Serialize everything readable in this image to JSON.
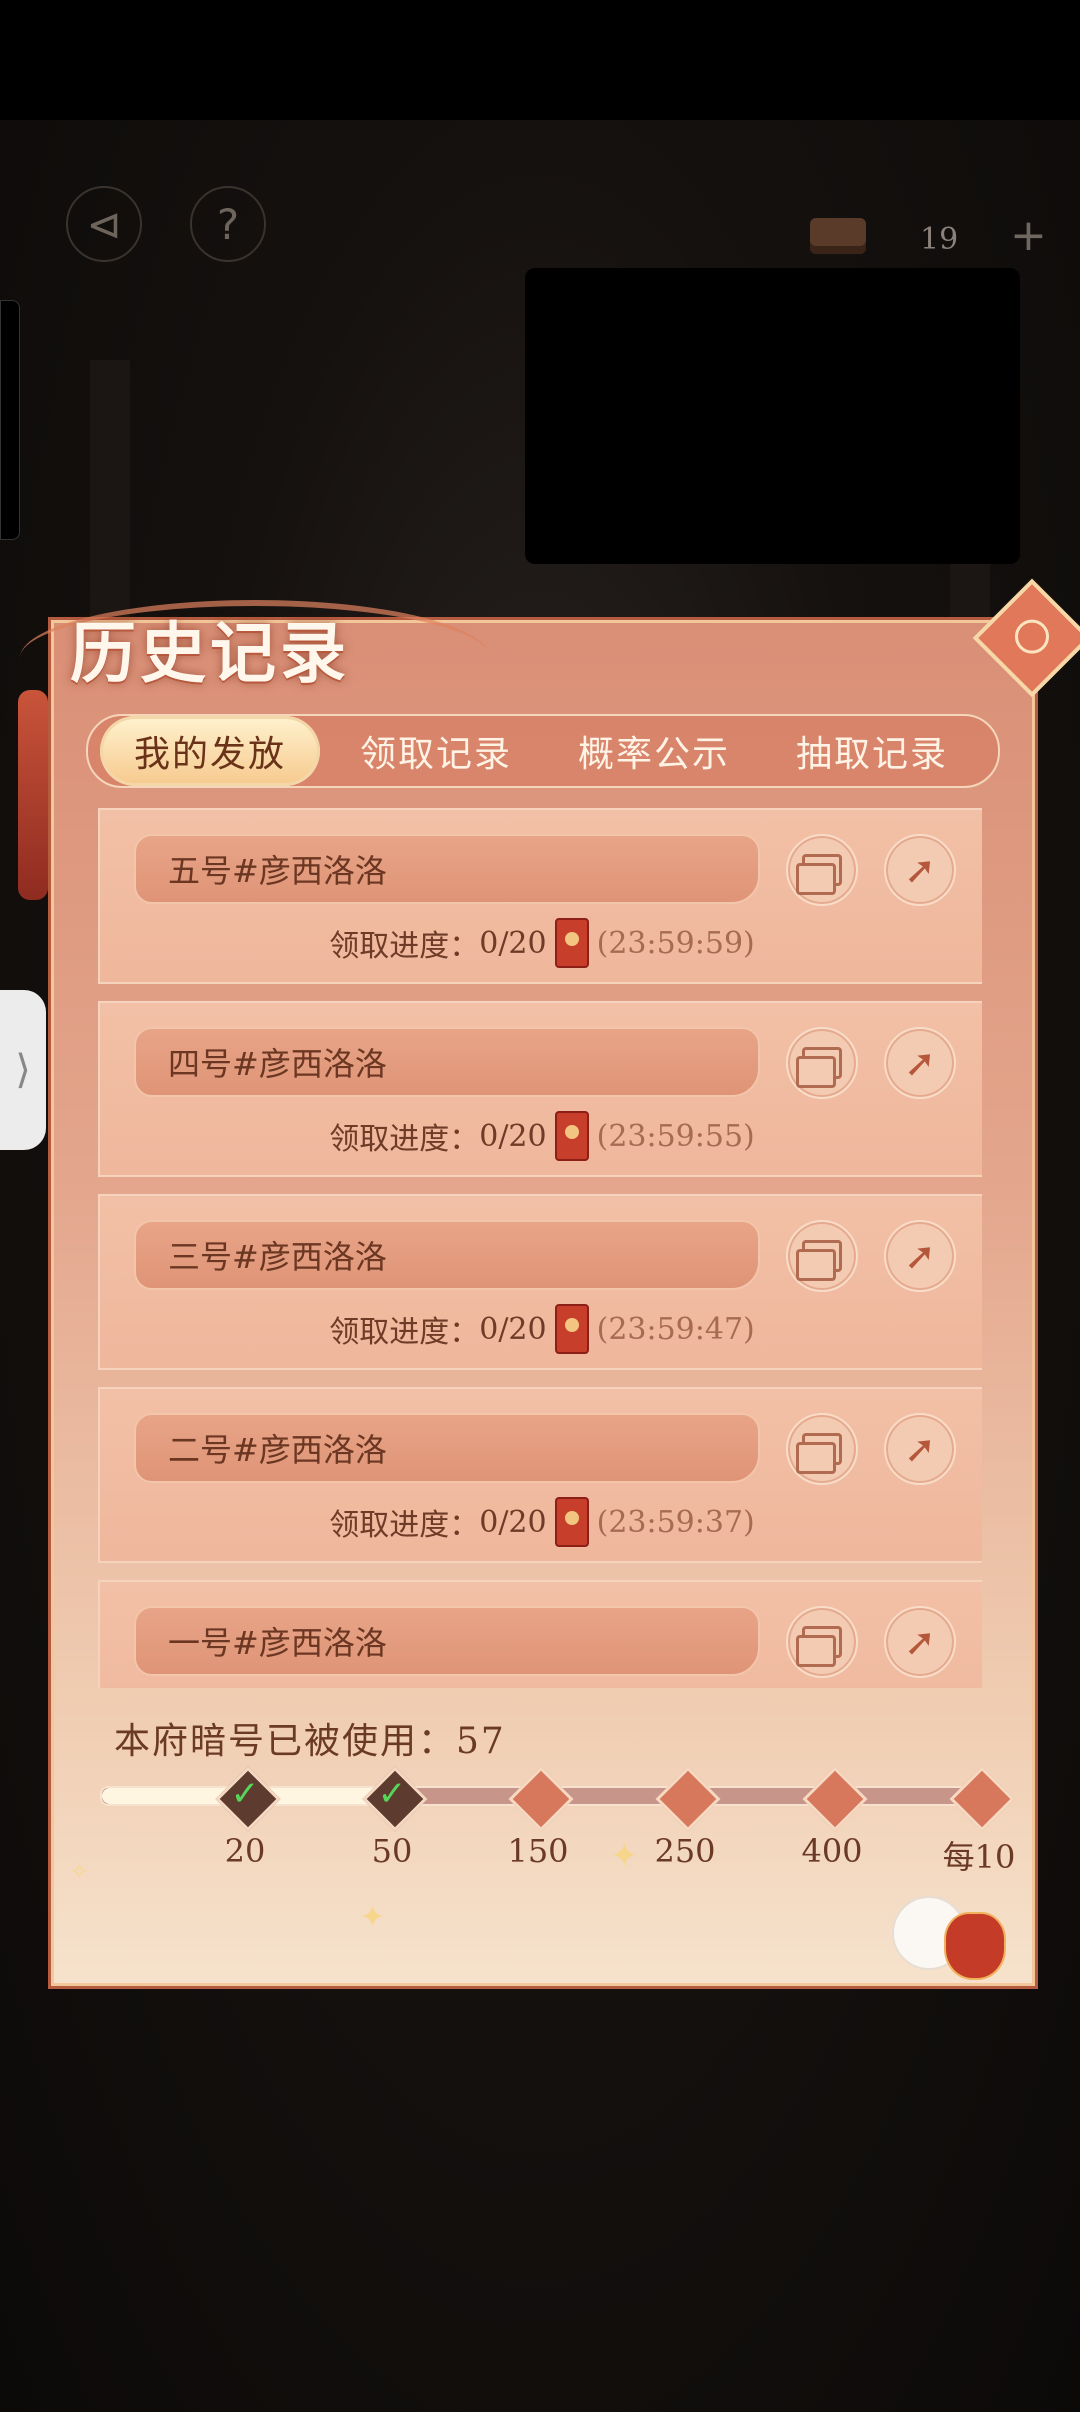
{
  "hud": {
    "back_icon": "back-arrow-icon",
    "help_label": "?",
    "resource_count": "19",
    "add_label": "+"
  },
  "panel": {
    "title": "历史记录"
  },
  "tabs": [
    {
      "label": "我的发放",
      "active": true
    },
    {
      "label": "领取记录",
      "active": false
    },
    {
      "label": "概率公示",
      "active": false
    },
    {
      "label": "抽取记录",
      "active": false
    }
  ],
  "records": [
    {
      "name": "五号#彦西洛洛",
      "progress_label": "领取进度：",
      "progress": "0/20",
      "time": "(23:59:59)"
    },
    {
      "name": "四号#彦西洛洛",
      "progress_label": "领取进度：",
      "progress": "0/20",
      "time": "(23:59:55)"
    },
    {
      "name": "三号#彦西洛洛",
      "progress_label": "领取进度：",
      "progress": "0/20",
      "time": "(23:59:47)"
    },
    {
      "name": "二号#彦西洛洛",
      "progress_label": "领取进度：",
      "progress": "0/20",
      "time": "(23:59:37)"
    },
    {
      "name": "一号#彦西洛洛",
      "progress_label": "",
      "progress": "",
      "time": ""
    }
  ],
  "usage": {
    "label": "本府暗号已被使用：57",
    "used": 57
  },
  "milestones": [
    {
      "label": "20",
      "done": true
    },
    {
      "label": "50",
      "done": true
    },
    {
      "label": "150",
      "done": false
    },
    {
      "label": "250",
      "done": false
    },
    {
      "label": "400",
      "done": false
    },
    {
      "label": "每10",
      "done": false
    }
  ],
  "colors": {
    "panel_accent": "#d98f76",
    "tab_active": "#f6c98d",
    "text_brown": "#6b3a25"
  }
}
